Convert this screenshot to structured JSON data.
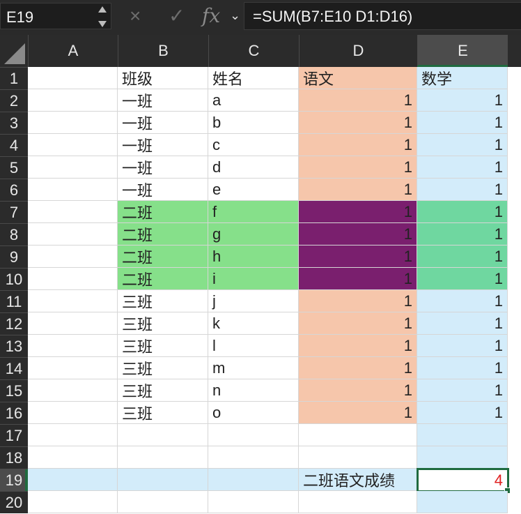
{
  "namebox": {
    "value": "E19"
  },
  "formula_bar": {
    "fx_label": "fx",
    "cancel_icon": "×",
    "confirm_icon": "✓",
    "formula": "=SUM(B7:E10 D1:D16)"
  },
  "columns": [
    "A",
    "B",
    "C",
    "D",
    "E"
  ],
  "selected_column": "E",
  "rows": [
    "1",
    "2",
    "3",
    "4",
    "5",
    "6",
    "7",
    "8",
    "9",
    "10",
    "11",
    "12",
    "13",
    "14",
    "15",
    "16",
    "17",
    "18",
    "19",
    "20"
  ],
  "selected_row": "19",
  "sheet": {
    "headers": {
      "b": "班级",
      "c": "姓名",
      "d": "语文",
      "e": "数学"
    },
    "records": [
      {
        "b": "一班",
        "c": "a",
        "d": "1",
        "e": "1"
      },
      {
        "b": "一班",
        "c": "b",
        "d": "1",
        "e": "1"
      },
      {
        "b": "一班",
        "c": "c",
        "d": "1",
        "e": "1"
      },
      {
        "b": "一班",
        "c": "d",
        "d": "1",
        "e": "1"
      },
      {
        "b": "一班",
        "c": "e",
        "d": "1",
        "e": "1"
      },
      {
        "b": "二班",
        "c": "f",
        "d": "1",
        "e": "1"
      },
      {
        "b": "二班",
        "c": "g",
        "d": "1",
        "e": "1"
      },
      {
        "b": "二班",
        "c": "h",
        "d": "1",
        "e": "1"
      },
      {
        "b": "二班",
        "c": "i",
        "d": "1",
        "e": "1"
      },
      {
        "b": "三班",
        "c": "j",
        "d": "1",
        "e": "1"
      },
      {
        "b": "三班",
        "c": "k",
        "d": "1",
        "e": "1"
      },
      {
        "b": "三班",
        "c": "l",
        "d": "1",
        "e": "1"
      },
      {
        "b": "三班",
        "c": "m",
        "d": "1",
        "e": "1"
      },
      {
        "b": "三班",
        "c": "n",
        "d": "1",
        "e": "1"
      },
      {
        "b": "三班",
        "c": "o",
        "d": "1",
        "e": "1"
      }
    ],
    "result_label": "二班语文成绩",
    "result_value": "4"
  },
  "colors": {
    "range_d1_d16": "#f6c6ab",
    "range_b7_e10": "#86e08a",
    "intersection": "#7a1f6e",
    "intersection_e": "#6fd7a0",
    "column_e": "#d3ecfa",
    "row_19": "#d3ecfa",
    "active_border": "#1f6b3f",
    "result_text": "#e02020"
  }
}
